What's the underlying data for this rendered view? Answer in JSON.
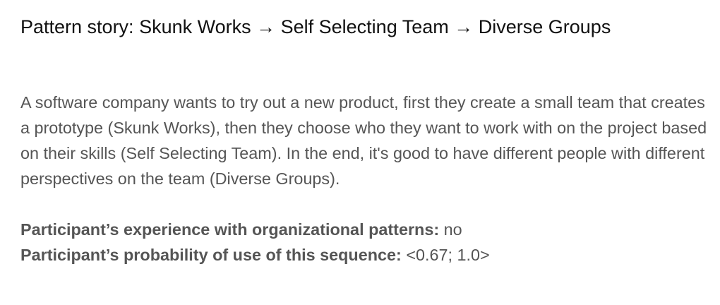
{
  "title": "Pattern story: Skunk Works → Self Selecting Team → Diverse Groups",
  "story": "A software company wants to try out a new product, first they create a small team that creates a prototype (Skunk Works), then they choose who they want to work with on the project based on their skills (Self Selecting Team). In the end, it's good to have different people with different perspectives on the team (Diverse Groups).",
  "experience": {
    "label": "Participant’s experience with organizational patterns:",
    "value": "no"
  },
  "probability": {
    "label": "Participant’s probability of use of this sequence:",
    "value": "<0.67; 1.0>"
  }
}
